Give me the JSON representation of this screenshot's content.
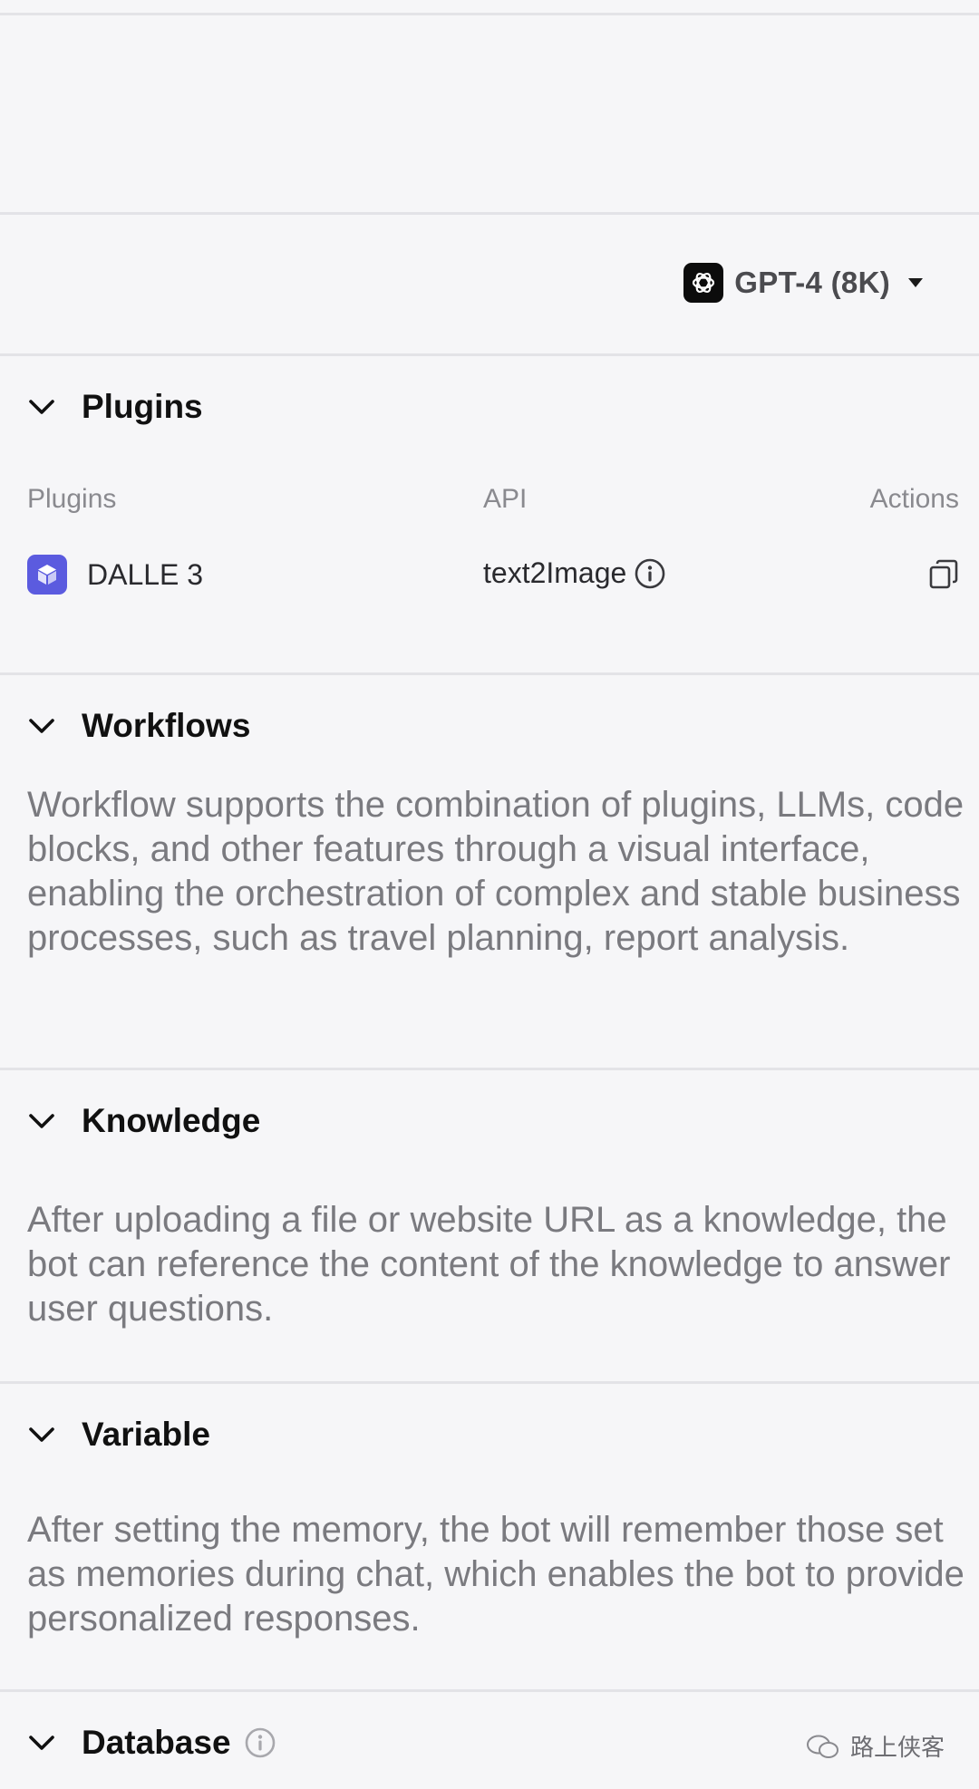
{
  "model": {
    "label": "GPT-4 (8K)",
    "icon": "openai-logo-icon"
  },
  "plugins": {
    "title": "Plugins",
    "columns": {
      "plugins": "Plugins",
      "api": "API",
      "actions": "Actions"
    },
    "rows": [
      {
        "name": "DALLE 3",
        "api": "text2Image"
      }
    ]
  },
  "workflows": {
    "title": "Workflows",
    "description": "Workflow supports the combination of plugins, LLMs, code blocks, and other features through a visual interface, enabling the orchestration of complex and stable business processes, such as travel planning, report analysis."
  },
  "knowledge": {
    "title": "Knowledge",
    "description": "After uploading a file or website URL as a knowledge, the bot can reference the content of the knowledge to answer user questions."
  },
  "variable": {
    "title": "Variable",
    "description": "After setting the memory, the bot will remember those set as memories during chat, which enables the bot to provide personalized responses."
  },
  "database": {
    "title": "Database"
  },
  "watermark": {
    "text": "路上侠客"
  },
  "colors": {
    "background": "#f6f6f8",
    "divider": "#e3e3e7",
    "plugin_icon": "#5b5bdf",
    "muted_text": "#7a7a7f"
  }
}
